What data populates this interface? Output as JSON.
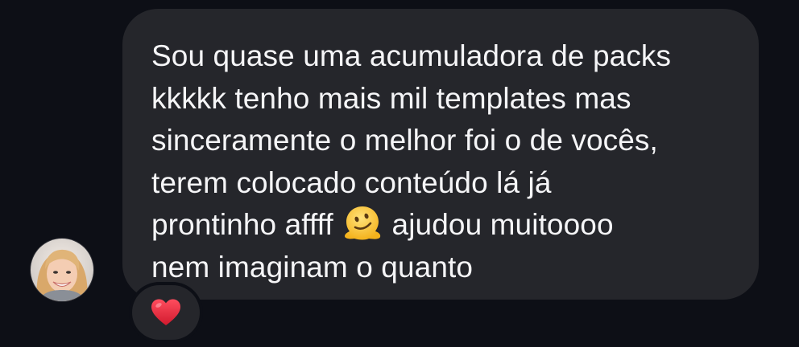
{
  "message": {
    "lines": [
      "Sou quase uma acumuladora de packs",
      "kkkkk tenho mais mil templates mas",
      "sinceramente o melhor foi o de vocês,",
      "terem colocado conteúdo lá já",
      "prontinho affff",
      "ajudou muitoooo",
      "nem imaginam o quanto"
    ],
    "inline_emoji": "melting-face-icon"
  },
  "reaction": {
    "icon": "red-heart-icon",
    "color": "#e0243a"
  },
  "avatar": {
    "icon": "profile-photo"
  },
  "colors": {
    "background": "#0d0f16",
    "bubble": "#25262b",
    "text": "#f5f5f7"
  }
}
